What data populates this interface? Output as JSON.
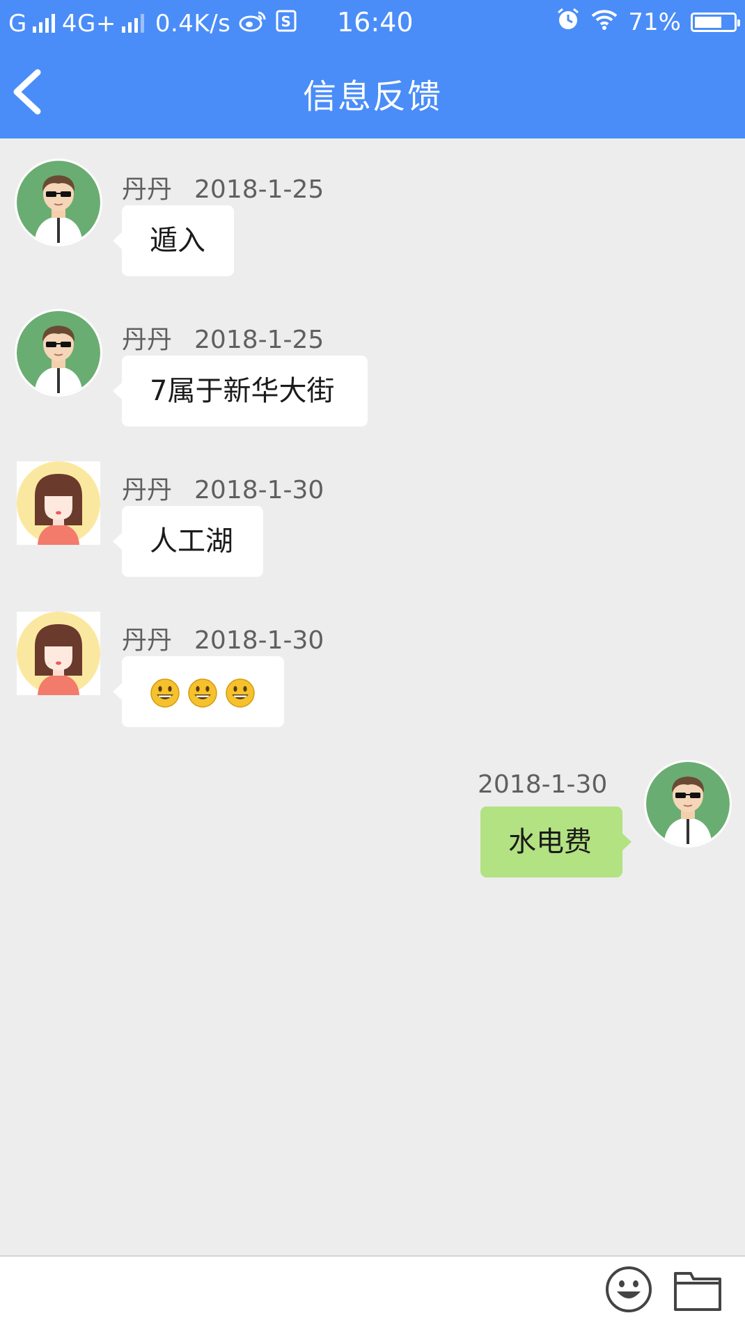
{
  "statusbar": {
    "carrier1": "G",
    "carrier2": "4G+",
    "speed": "0.4K/s",
    "time": "16:40",
    "battery": "71%",
    "battery_level": 0.71
  },
  "header": {
    "title": "信息反馈"
  },
  "messages": [
    {
      "sender": "丹丹",
      "date": "2018-1-25",
      "text": "遁入",
      "avatar": "male-avatar"
    },
    {
      "sender": "丹丹",
      "date": "2018-1-25",
      "text": "7属于新华大街",
      "avatar": "male-avatar"
    },
    {
      "sender": "丹丹",
      "date": "2018-1-30",
      "text": "人工湖",
      "avatar": "female-avatar"
    },
    {
      "sender": "丹丹",
      "date": "2018-1-30",
      "text": "",
      "emoji_count": 3,
      "avatar": "female-avatar"
    },
    {
      "sender": "",
      "date": "2018-1-30",
      "text": "水电费",
      "avatar": "male-avatar",
      "outgoing": true
    }
  ],
  "inputbar": {
    "placeholder": "",
    "value": ""
  },
  "colors": {
    "header_bg": "#4a8df8",
    "chat_bg": "#ededed",
    "incoming_bubble": "#ffffff",
    "outgoing_bubble": "#b2e281"
  }
}
